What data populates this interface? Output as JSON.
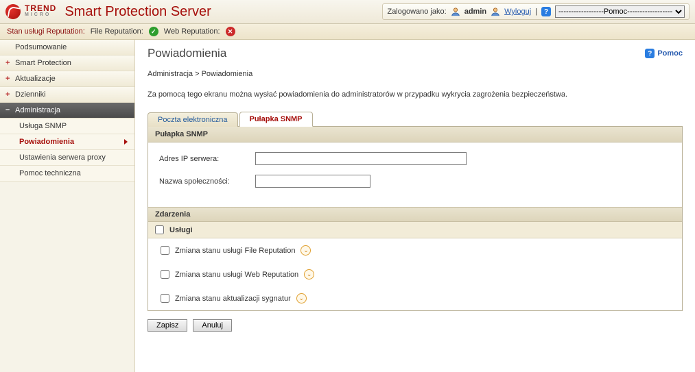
{
  "header": {
    "brand_line1": "TREND",
    "brand_line2": "MICRO",
    "product_title": "Smart Protection Server",
    "logged_in_label": "Zalogowano jako:",
    "username": "admin",
    "logout_label": "Wyloguj",
    "help_select_value": "------------------Pomoc------------------"
  },
  "status": {
    "left_label": "Stan usługi Reputation:",
    "file_rep_label": "File Reputation:",
    "web_rep_label": "Web Reputation:"
  },
  "sidebar": {
    "items": [
      {
        "label": "Podsumowanie"
      },
      {
        "label": "Smart Protection"
      },
      {
        "label": "Aktualizacje"
      },
      {
        "label": "Dzienniki"
      },
      {
        "label": "Administracja"
      }
    ],
    "subitems": [
      {
        "label": "Usługa SNMP"
      },
      {
        "label": "Powiadomienia"
      },
      {
        "label": "Ustawienia serwera proxy"
      },
      {
        "label": "Pomoc techniczna"
      }
    ]
  },
  "page": {
    "title": "Powiadomienia",
    "help_label": "Pomoc",
    "breadcrumb_root": "Administracja",
    "breadcrumb_sep": ">",
    "breadcrumb_leaf": "Powiadomienia",
    "intro": "Za pomocą tego ekranu można wysłać powiadomienia do administratorów w przypadku wykrycia zagrożenia bezpieczeństwa."
  },
  "tabs": {
    "email": "Poczta elektroniczna",
    "snmp": "Pułapka SNMP"
  },
  "panel": {
    "title": "Pułapka SNMP",
    "ip_label": "Adres IP serwera:",
    "ip_value": "",
    "community_label": "Nazwa społeczności:",
    "community_value": "",
    "events_header": "Zdarzenia",
    "services_header": "Usługi",
    "checks": [
      {
        "label": "Zmiana stanu usługi File Reputation"
      },
      {
        "label": "Zmiana stanu usługi Web Reputation"
      },
      {
        "label": "Zmiana stanu aktualizacji sygnatur"
      }
    ]
  },
  "buttons": {
    "save": "Zapisz",
    "cancel": "Anuluj"
  }
}
